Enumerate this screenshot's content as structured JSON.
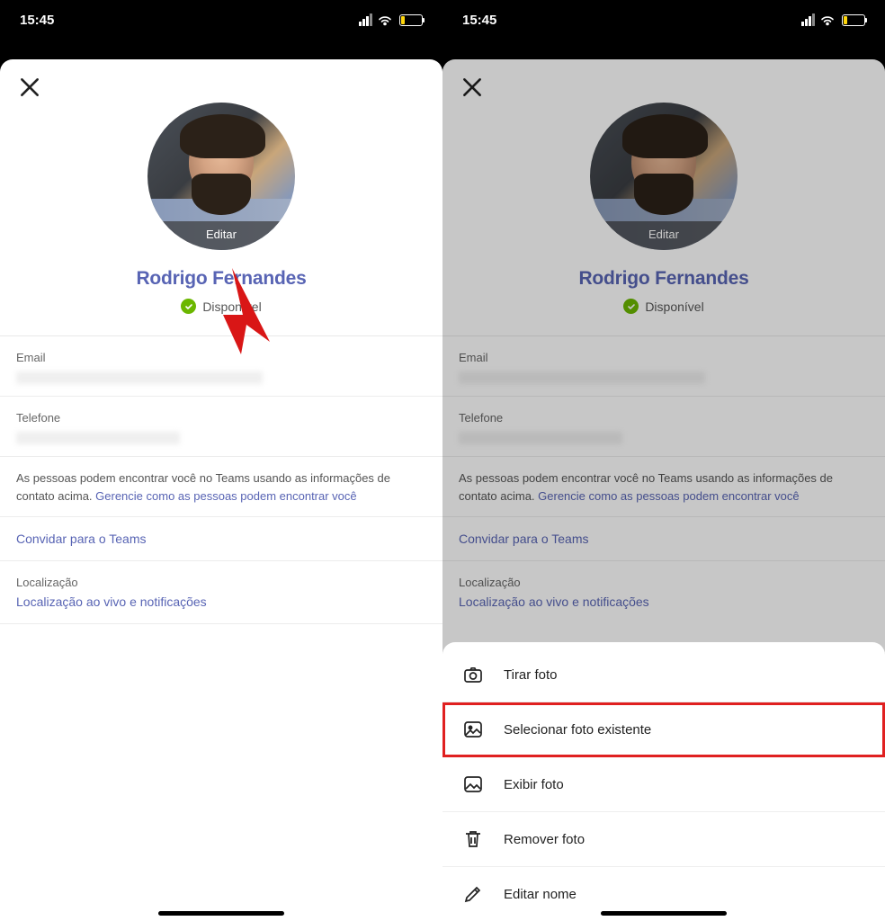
{
  "status_bar": {
    "time": "15:45"
  },
  "profile": {
    "edit_avatar_label": "Editar",
    "name": "Rodrigo Fernandes",
    "status_text": "Disponível"
  },
  "fields": {
    "email_label": "Email",
    "phone_label": "Telefone"
  },
  "info": {
    "text_prefix": "As pessoas podem encontrar você no Teams usando as informações de contato acima. ",
    "link": "Gerencie como as pessoas podem encontrar você"
  },
  "links": {
    "invite": "Convidar para o Teams",
    "location_label": "Localização",
    "location_link": "Localização ao vivo e notificações"
  },
  "sheet": {
    "items": [
      {
        "label": "Tirar foto"
      },
      {
        "label": "Selecionar foto existente"
      },
      {
        "label": "Exibir foto"
      },
      {
        "label": "Remover foto"
      },
      {
        "label": "Editar nome"
      }
    ]
  }
}
